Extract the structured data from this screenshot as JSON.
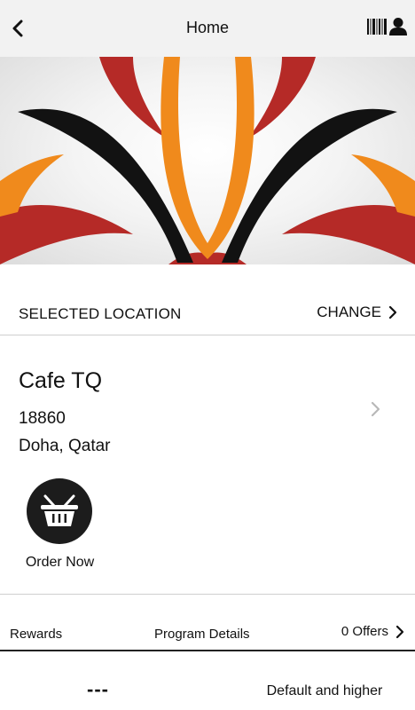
{
  "header": {
    "title": "Home",
    "back_icon": "back-chevron-icon",
    "barcode_icon": "barcode-icon",
    "user_icon": "user-icon"
  },
  "hero": {
    "image": "lotus-logo",
    "colors": {
      "orange": "#f08a1c",
      "red": "#b52a27",
      "black": "#121212"
    }
  },
  "location_section": {
    "label": "SELECTED LOCATION",
    "change_label": "CHANGE"
  },
  "location": {
    "name": "Cafe TQ",
    "address_line1": "18860",
    "address_line2": "Doha, Qatar"
  },
  "order": {
    "label": "Order Now",
    "icon": "basket-icon"
  },
  "rewards": {
    "label": "Rewards",
    "program_details": "Program Details",
    "offers": "0 Offers",
    "points": "---",
    "tier": "Default and higher"
  }
}
